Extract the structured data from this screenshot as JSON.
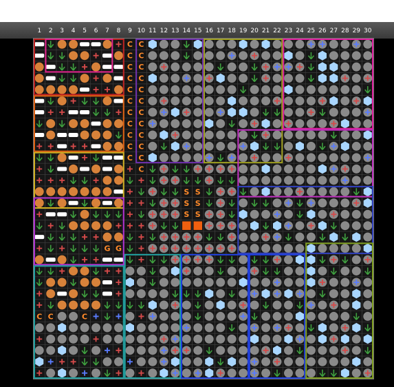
{
  "header": {
    "columns": [
      "1",
      "2",
      "3",
      "4",
      "5",
      "6",
      "7",
      "8",
      "9",
      "10",
      "11",
      "12",
      "13",
      "14",
      "15",
      "16",
      "17",
      "18",
      "19",
      "20",
      "21",
      "22",
      "23",
      "24",
      "25",
      "26",
      "27",
      "28",
      "29",
      "30"
    ]
  },
  "board": {
    "cols": 30,
    "rows": 30,
    "letters": {
      "C": "C",
      "S": "S",
      "G": "G"
    },
    "colors": {
      "background": "#161616",
      "grid": "#3a3a3a",
      "disc": "#8a8a8a",
      "orange_disc": "#d8823a",
      "hex": "#a9d6ff",
      "plus": "#d64a4a",
      "plus_blue": "#5a7cff",
      "arrow": "#3fa03f",
      "orange_square": "#f06010",
      "letter": "#ff8a2a"
    },
    "regions": [
      {
        "name": "top-left-red-1",
        "color": "#c02020"
      },
      {
        "name": "top-left-pink",
        "color": "#e0208a"
      },
      {
        "name": "left-orange",
        "color": "#e06010"
      },
      {
        "name": "left-yellow",
        "color": "#d0b020"
      },
      {
        "name": "left-purple",
        "color": "#b030d0"
      },
      {
        "name": "top-mid-purple",
        "color": "#7030b0"
      },
      {
        "name": "top-mid-olive",
        "color": "#a0a020"
      },
      {
        "name": "top-right-magenta",
        "color": "#e020a0"
      },
      {
        "name": "right-mid-magenta",
        "color": "#c030c0"
      },
      {
        "name": "right-blue",
        "color": "#3040c0"
      },
      {
        "name": "bottom-teal",
        "color": "#20a0a0"
      },
      {
        "name": "bottom-blue",
        "color": "#2040e0"
      },
      {
        "name": "bottom-olive",
        "color": "#80a020"
      }
    ]
  }
}
